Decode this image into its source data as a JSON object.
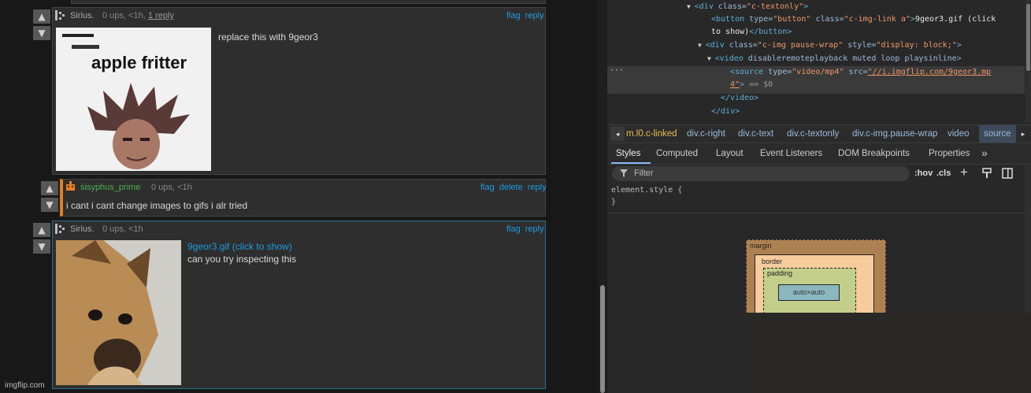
{
  "votes": {
    "up": "▲",
    "down": "▼"
  },
  "comments": [
    {
      "user": "Sirius.",
      "meta": "0 ups, <1h,",
      "reply_count": "1 reply",
      "actions": [
        "flag",
        "reply"
      ],
      "text": "replace this with 9geor3",
      "image_caption": "apple fritter"
    },
    {
      "user": "sisyphus_prime",
      "meta": "0 ups, <1h",
      "actions": [
        "flag",
        "delete",
        "reply"
      ],
      "text": "i cant i cant change images to gifs i alr tried"
    },
    {
      "user": "Sirius.",
      "meta": "0 ups, <1h",
      "actions": [
        "flag",
        "reply"
      ],
      "link": "9geor3.gif (click to show)",
      "text": "can you try inspecting this"
    }
  ],
  "watermark": "imgflip.com",
  "devtools": {
    "code_lines": [
      {
        "indent": 0,
        "arrow": "▼",
        "parts": [
          [
            "tag",
            "<div "
          ],
          [
            "attr",
            "class="
          ],
          [
            "val",
            "\"c-textonly\""
          ],
          [
            "tag",
            ">"
          ]
        ]
      },
      {
        "indent": 1,
        "arrow": "",
        "parts": [
          [
            "tag",
            "<button "
          ],
          [
            "attr",
            "type="
          ],
          [
            "val",
            "\"button\" "
          ],
          [
            "attr",
            "class="
          ],
          [
            "val",
            "\"c-img-link a\""
          ],
          [
            "tag",
            ">"
          ],
          [
            "txt",
            "9geor3.gif (click"
          ]
        ]
      },
      {
        "indent": 1,
        "arrow": "",
        "parts": [
          [
            "txt",
            "to show)"
          ],
          [
            "tag",
            "</button>"
          ]
        ]
      },
      {
        "indent": 1,
        "arrow": "▼",
        "parts": [
          [
            "tag",
            "<div "
          ],
          [
            "attr",
            "class="
          ],
          [
            "val",
            "\"c-img pause-wrap\" "
          ],
          [
            "attr",
            "style="
          ],
          [
            "val",
            "\"display: block;\""
          ],
          [
            "tag",
            ">"
          ]
        ]
      },
      {
        "indent": 2,
        "arrow": "▼",
        "parts": [
          [
            "tag",
            "<video "
          ],
          [
            "attr",
            "disableremoteplayback muted loop playsinline"
          ],
          [
            "tag",
            ">"
          ]
        ]
      },
      {
        "indent": 3,
        "arrow": "",
        "parts": [
          [
            "tag",
            "<source "
          ],
          [
            "attr",
            "type="
          ],
          [
            "val",
            "\"video/mp4\" "
          ],
          [
            "attr",
            "src="
          ],
          [
            "val",
            "\"//i.imgflip.com/9geor3.mp"
          ]
        ]
      },
      {
        "indent": 3,
        "arrow": "",
        "parts": [
          [
            "val",
            "4\""
          ],
          [
            "tag",
            "> "
          ],
          [
            "dim",
            "== $0"
          ]
        ]
      },
      {
        "indent": 2,
        "arrow": "",
        "parts": [
          [
            "tag",
            "</video>"
          ]
        ]
      },
      {
        "indent": 1,
        "arrow": "",
        "parts": [
          [
            "tag",
            "</div>"
          ]
        ]
      }
    ],
    "breadcrumbs": [
      "m.l0.c-linked",
      "div.c-right",
      "div.c-text",
      "div.c-textonly",
      "div.c-img.pause-wrap",
      "video",
      "source"
    ],
    "tabs": [
      "Styles",
      "Computed",
      "Layout",
      "Event Listeners",
      "DOM Breakpoints",
      "Properties"
    ],
    "filter_placeholder": "Filter",
    "hov": ":hov",
    "cls": ".cls",
    "element_style": "element.style {",
    "close_brace": "}",
    "box": {
      "margin": "margin",
      "border": "border",
      "padding": "padding",
      "content": "auto×auto"
    }
  }
}
